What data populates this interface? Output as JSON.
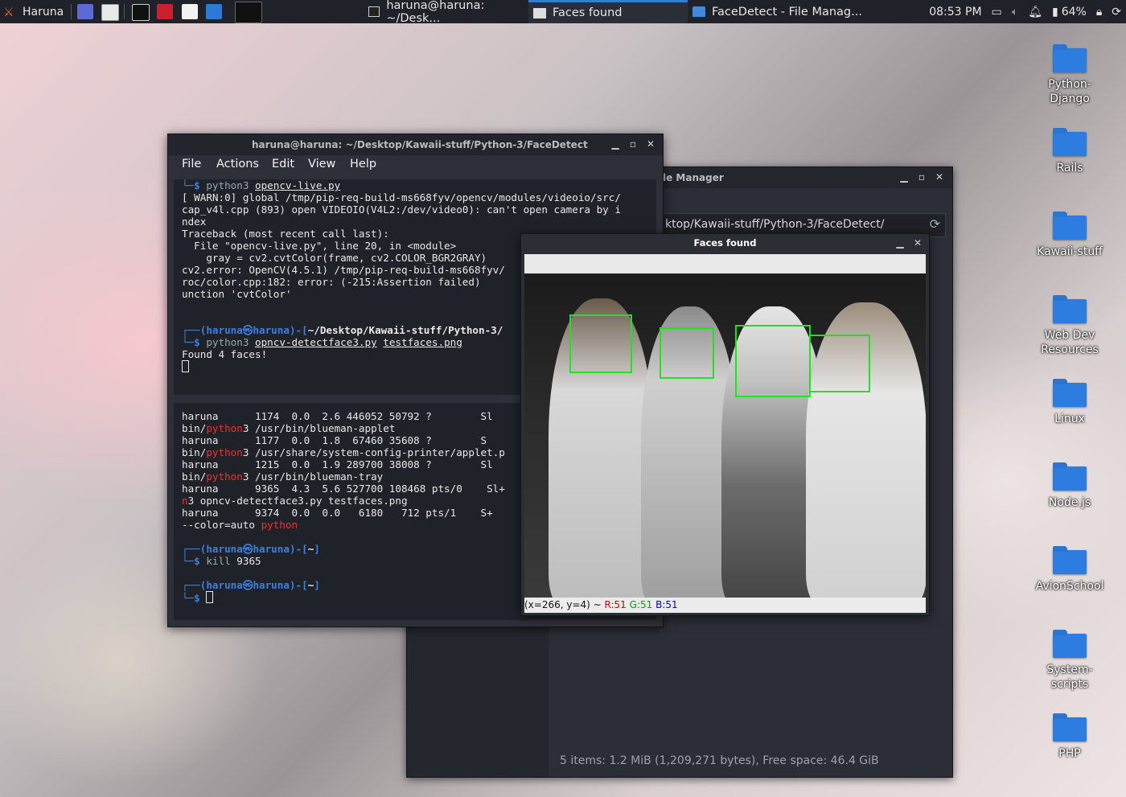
{
  "panel": {
    "menu_label": "Haruna",
    "tasks": [
      {
        "label": "haruna@haruna: ~/Desk...",
        "active": false
      },
      {
        "label": "Faces found",
        "active": true
      },
      {
        "label": "FaceDetect - File Manag...",
        "active": false
      }
    ],
    "clock": "08:53 PM",
    "battery": "64%"
  },
  "desktop_icons": [
    "Python-\nDjango",
    "Rails",
    "Kawaii-stuff",
    "Web Dev\nResources",
    "Linux",
    "Node.js",
    "AvionSchool",
    "System-\nscripts",
    "PHP"
  ],
  "file_manager": {
    "title_partial": "le Manager",
    "path_partial": "ktop/Kawaii-stuff/Python-3/FaceDetect/",
    "status": "5 items: 1.2 MiB (1,209,271 bytes), Free space: 46.4 GiB"
  },
  "terminal": {
    "title": "haruna@haruna: ~/Desktop/Kawaii-stuff/Python-3/FaceDetect",
    "menu": [
      "File",
      "Actions",
      "Edit",
      "View",
      "Help"
    ],
    "pane1": {
      "cmd1": "python3",
      "cmd1_arg": "opencv-live.py",
      "warn1": "[ WARN:0] global /tmp/pip-req-build-ms668fyv/opencv/modules/videoio/src/",
      "warn2": "cap_v4l.cpp (893) open VIDEOIO(V4L2:/dev/video0): can't open camera by i",
      "warn3": "ndex",
      "tb": "Traceback (most recent call last):",
      "tb2": "  File \"opencv-live.py\", line 20, in <module>",
      "tb3": "    gray = cv2.cvtColor(frame, cv2.COLOR_BGR2GRAY)",
      "tb4": "cv2.error: OpenCV(4.5.1) /tmp/pip-req-build-ms668fyv/",
      "tb5": "roc/color.cpp:182: error: (-215:Assertion failed)",
      "tb6": "unction 'cvtColor'",
      "prompt_user": "haruna",
      "prompt_host": "haruna",
      "prompt_path": "~/Desktop/Kawaii-stuff/Python-3/",
      "cmd2": "python3",
      "cmd2_arg1": "opncv-detectface3.py",
      "cmd2_arg2": "testfaces.png",
      "out": "Found 4 faces!"
    },
    "pane2": {
      "l1": "haruna      1174  0.0  2.6 446052 50792 ?        Sl",
      "l2a": "bin/",
      "l2b": "python",
      "l2c": "3 /usr/bin/blueman-applet",
      "l3": "haruna      1177  0.0  1.8  67460 35608 ?        S",
      "l4a": "bin/",
      "l4b": "python",
      "l4c": "3 /usr/share/system-config-printer/applet.p",
      "l5": "haruna      1215  0.0  1.9 289700 38008 ?        Sl",
      "l6a": "bin/",
      "l6b": "python",
      "l6c": "3 /usr/bin/blueman-tray",
      "l7": "haruna      9365  4.3  5.6 527700 108468 pts/0    Sl+",
      "l8a": "n",
      "l8b": "3 opncv-detectface3.py testfaces.png",
      "l9": "haruna      9374  0.0  0.0   6180   712 pts/1    S+",
      "l10a": "--color=auto ",
      "l10b": "python",
      "p_path": "~",
      "cmd": "kill",
      "cmd_arg": "9365"
    }
  },
  "faces_window": {
    "title": "Faces found",
    "status_prefix": "(x=266, y=4) ~ ",
    "r": "R:51",
    "g": "G:51",
    "b": "B:51",
    "detected_count": 4
  }
}
